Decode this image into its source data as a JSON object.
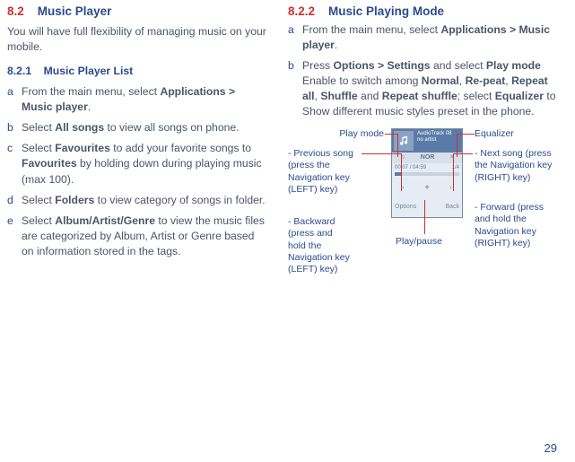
{
  "page_number": "29",
  "left": {
    "sec_num": "8.2",
    "sec_title": "Music Player",
    "intro": "You will have full flexibility of managing music on your mobile.",
    "sub_num": "8.2.1",
    "sub_title": "Music Player List",
    "steps": {
      "a": {
        "letter": "a",
        "pre": "From the main menu, select ",
        "bold": "Applications > Music player",
        "post": "."
      },
      "b": {
        "letter": "b",
        "pre": "Select ",
        "bold": "All songs",
        "post": " to view all songs on phone."
      },
      "c": {
        "letter": "c",
        "pre": "Select ",
        "bold1": "Favourites",
        "mid": " to add your favorite songs to ",
        "bold2": "Favourites",
        "post": " by holding down during playing music (max 100)."
      },
      "d": {
        "letter": "d",
        "pre": "Select ",
        "bold": "Folders",
        "post": " to view category of songs in folder."
      },
      "e": {
        "letter": "e",
        "pre": "Select ",
        "bold": "Album/Artist/Genre",
        "post": " to view the music files are categorized by Album, Artist or Genre based on information stored in the tags."
      }
    }
  },
  "right": {
    "sec_num": "8.2.2",
    "sec_title": "Music Playing Mode",
    "steps": {
      "a": {
        "letter": "a",
        "pre": "From the main menu, select ",
        "bold": "Applications > Music player",
        "post": "."
      },
      "b": {
        "letter": "b",
        "pre": "Press ",
        "bold1": "Options > Settings",
        "mid1": " and select ",
        "bold2": "Play mode",
        "mid2": " Enable to switch among ",
        "bold3": "Normal",
        "c1": ", ",
        "bold4": "Re-peat",
        "c2": ", ",
        "bold5": "Repeat all",
        "c3": ", ",
        "bold6": "Shuffle",
        "mid3": " and ",
        "bold7": "Repeat shuffle",
        "mid4": "; select ",
        "bold8": "Equalizer",
        "post": " to Show different music styles preset in the phone."
      }
    },
    "diagram": {
      "play_mode": "Play mode",
      "equalizer": "Equalizer",
      "prev_song": "- Previous song (press the Navigation key (LEFT) key)",
      "backward": "- Backward (press and hold the Navigation key (LEFT) key)",
      "play_pause": "Play/pause",
      "next_song": "- Next song (press the Navigation key (RIGHT) key)",
      "forward": "- Forward (press and hold the Navigation key (RIGHT) key)",
      "screen": {
        "track_title": "AudioTrack 08",
        "artist": "no artist",
        "mode_indicator": "NOR",
        "time_elapsed": "00:07",
        "time_total": "/ 04:59",
        "track_index": "1/4",
        "soft_left": "Options",
        "soft_right": "Back"
      }
    }
  }
}
